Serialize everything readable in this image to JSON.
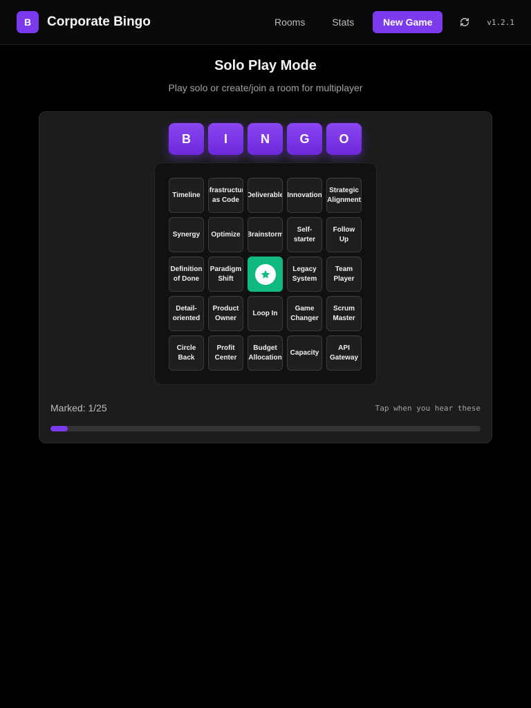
{
  "header": {
    "logo_letter": "B",
    "title": "Corporate Bingo",
    "nav": {
      "rooms": "Rooms",
      "stats": "Stats"
    },
    "new_game": "New Game",
    "refresh_icon": "refresh-icon",
    "version": "v1.2.1"
  },
  "main": {
    "title": "Solo Play Mode",
    "subtitle": "Play solo or create/join a room for multiplayer"
  },
  "board": {
    "letters": [
      "B",
      "I",
      "N",
      "G",
      "O"
    ],
    "cells": [
      {
        "label": "Timeline"
      },
      {
        "label": "Infrastructure as Code"
      },
      {
        "label": "Deliverable"
      },
      {
        "label": "Innovation"
      },
      {
        "label": "Strategic Alignment"
      },
      {
        "label": "Synergy"
      },
      {
        "label": "Optimize"
      },
      {
        "label": "Brainstorm"
      },
      {
        "label": "Self-starter"
      },
      {
        "label": "Follow Up"
      },
      {
        "label": "Definition of Done"
      },
      {
        "label": "Paradigm Shift"
      },
      {
        "label": "",
        "free": true,
        "icon": "star-icon",
        "marked": true
      },
      {
        "label": "Legacy System"
      },
      {
        "label": "Team Player"
      },
      {
        "label": "Detail-oriented"
      },
      {
        "label": "Product Owner"
      },
      {
        "label": "Loop In"
      },
      {
        "label": "Game Changer"
      },
      {
        "label": "Scrum Master"
      },
      {
        "label": "Circle Back"
      },
      {
        "label": "Profit Center"
      },
      {
        "label": "Budget Allocation"
      },
      {
        "label": "Capacity"
      },
      {
        "label": "API Gateway"
      }
    ],
    "marked_text": "Marked: 1/25",
    "hint": "Tap when you hear these",
    "progress": 0.04
  },
  "colors": {
    "accent": "#7c3aed",
    "free_cell": "#10b981"
  }
}
